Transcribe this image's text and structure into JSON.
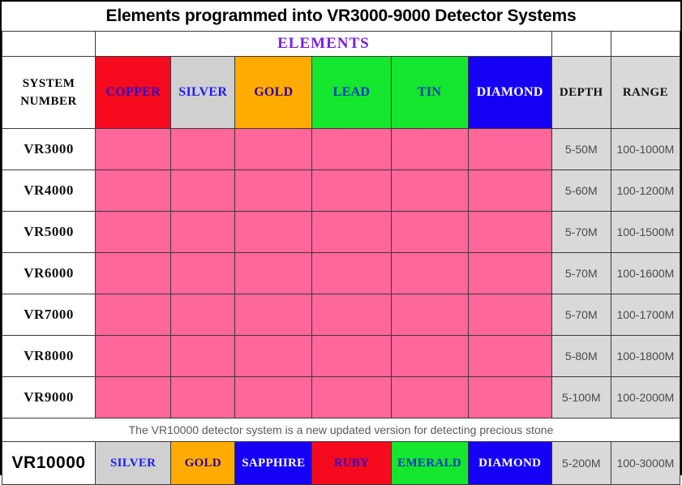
{
  "title": "Elements programmed into VR3000-9000 Detector Systems",
  "header": {
    "elements_band": "ELEMENTS",
    "system_number_line1": "SYSTEM",
    "system_number_line2": "NUMBER",
    "depth": "DEPTH",
    "range": "RANGE"
  },
  "element_columns": [
    {
      "label": "COPPER",
      "bg": "#f50a1e",
      "fg": "#3300cc"
    },
    {
      "label": "SILVER",
      "bg": "#d0d0d0",
      "fg": "#1a1aff"
    },
    {
      "label": "GOLD",
      "bg": "#ffab00",
      "fg": "#330099"
    },
    {
      "label": "LEAD",
      "bg": "#15e62e",
      "fg": "#0033cc"
    },
    {
      "label": "TIN",
      "bg": "#15e62e",
      "fg": "#0033cc"
    },
    {
      "label": "DIAMOND",
      "bg": "#1500f5",
      "fg": "#ffffff"
    }
  ],
  "rows": [
    {
      "system": "VR3000",
      "depth": "5-50M",
      "range": "100-1000M"
    },
    {
      "system": "VR4000",
      "depth": "5-60M",
      "range": "100-1200M"
    },
    {
      "system": "VR5000",
      "depth": "5-70M",
      "range": "100-1500M"
    },
    {
      "system": "VR6000",
      "depth": "5-70M",
      "range": "100-1600M"
    },
    {
      "system": "VR7000",
      "depth": "5-70M",
      "range": "100-1700M"
    },
    {
      "system": "VR8000",
      "depth": "5-80M",
      "range": "100-1800M"
    },
    {
      "system": "VR9000",
      "depth": "5-100M",
      "range": "100-2000M"
    }
  ],
  "note": "The VR10000 detector system is a new updated version for detecting precious stone",
  "last_row": {
    "system": "VR10000",
    "depth": "5-200M",
    "range": "100-3000M",
    "gems": [
      {
        "label": "SILVER",
        "bg": "#d0d0d0",
        "fg": "#1a1aff"
      },
      {
        "label": "GOLD",
        "bg": "#ffab00",
        "fg": "#330099"
      },
      {
        "label": "SAPPHIRE",
        "bg": "#1500f5",
        "fg": "#ffffff"
      },
      {
        "label": "RUBY",
        "bg": "#f50a1e",
        "fg": "#3300cc"
      },
      {
        "label": "EMERALD",
        "bg": "#15e62e",
        "fg": "#0033cc"
      },
      {
        "label": "DIAMOND",
        "bg": "#1500f5",
        "fg": "#ffffff"
      }
    ]
  },
  "colors": {
    "cell_pink": "#ff6699",
    "cell_gray": "#d9d9d9",
    "elements_purple": "#7a1ee6",
    "border": "#3a3a3a"
  }
}
